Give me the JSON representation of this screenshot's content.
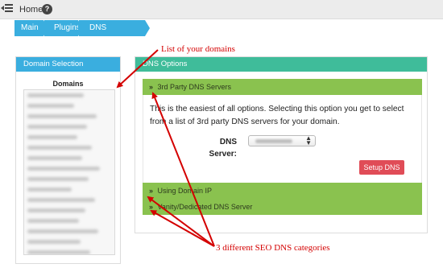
{
  "topbar": {
    "menu_icon": "menu-collapse-icon",
    "home_label": "Home",
    "help_icon_glyph": "?"
  },
  "breadcrumb": [
    "Main",
    "Plugins",
    "DNS Manager"
  ],
  "domain_panel": {
    "title": "Domain Selection",
    "list_heading": "Domains",
    "domain_count": 17
  },
  "dns_panel": {
    "title": "DNS Options",
    "section_icon": "double-chevron-right-icon",
    "sections": [
      "3rd Party DNS Servers",
      "Using Domain IP",
      "Vanity/Dedicated DNS Server"
    ],
    "description": "This is the easiest of all options. Selecting this option you get to select from a list of 3rd party DNS servers for your domain.",
    "dns_label_line1": "DNS",
    "dns_label_line2": "Server:",
    "setup_button": "Setup DNS"
  },
  "annotations": {
    "domains_note": "List of your domains",
    "categories_note": "3 different SEO DNS categories"
  },
  "colors": {
    "breadcrumb": "#3aaedf",
    "domain_header": "#3aaedf",
    "dns_header": "#3fbc9a",
    "section_bar": "#8ac24f",
    "setup_button": "#e04c57",
    "annotation": "#d40000"
  }
}
